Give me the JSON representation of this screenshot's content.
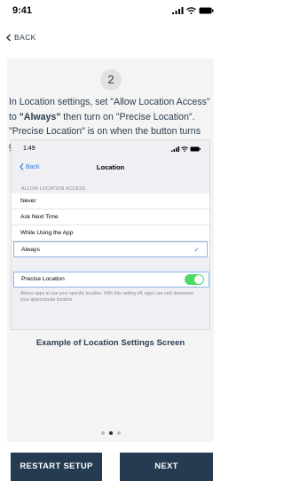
{
  "status_bar": {
    "time": "9:41"
  },
  "nav": {
    "back_label": "BACK"
  },
  "step": {
    "number": "2",
    "instructions": {
      "part1": "In Location settings, set \"Allow Location Access\" to ",
      "bold": "\"Always\"",
      "part2": " then turn on \"Precise Location\".  \"Precise Location\" is on when the button turns green."
    }
  },
  "example_screen": {
    "time": "1:49",
    "back_label": "Back",
    "title": "Location",
    "section_header": "ALLOW LOCATION ACCESS",
    "options": [
      "Never",
      "Ask Next Time",
      "While Using the App",
      "Always"
    ],
    "selected_option": "Always",
    "precise_location_label": "Precise Location",
    "precise_location_on": true,
    "footnote": "Allows apps to use your specific location. With this setting off, apps can only determine your approximate location."
  },
  "caption": "Example of Location Settings Screen",
  "pagination": {
    "total": 3,
    "current": 2
  },
  "buttons": {
    "restart_label": "RESTART SETUP",
    "next_label": "NEXT"
  },
  "colors": {
    "button_bg": "#243b52",
    "accent_blue": "#2f7be5",
    "toggle_green": "#4cd964"
  }
}
